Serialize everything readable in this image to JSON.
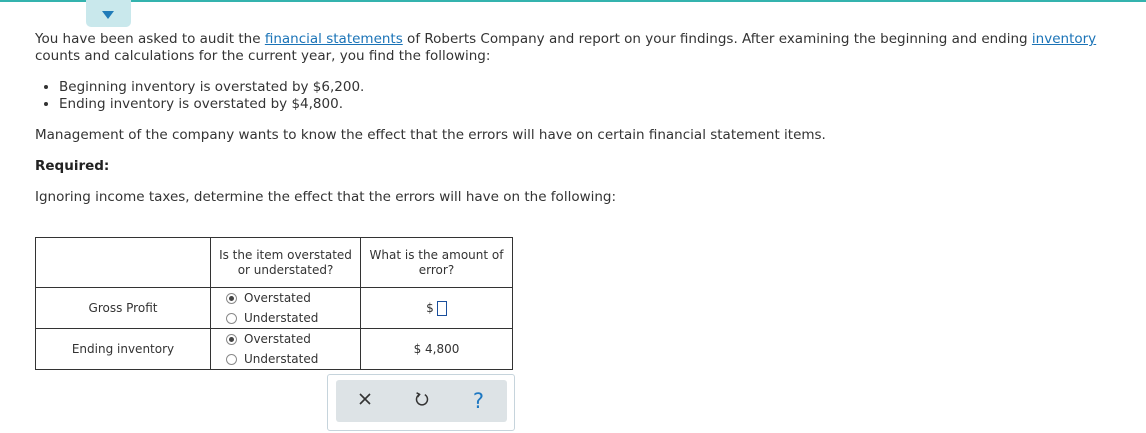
{
  "intro": {
    "part1": "You have been asked to audit the ",
    "link1": "financial statements",
    "part2": " of Roberts Company and report on your findings. After examining the beginning and ending ",
    "link2": "inventory",
    "line2": "counts and calculations for the current year, you find the following:"
  },
  "bullets": [
    "Beginning inventory is overstated by $6,200.",
    "Ending inventory is overstated by $4,800."
  ],
  "management_text": "Management of the company wants to know the effect that the errors will have on certain financial statement items.",
  "required_label": "Required:",
  "instruction": "Ignoring income taxes, determine the effect that the errors will have on the following:",
  "table": {
    "col2_header_line1": "Is the item overstated",
    "col2_header_line2": "or understated?",
    "col3_header_line1": "What is the amount of",
    "col3_header_line2": "error?",
    "rows": [
      {
        "item": "Gross Profit",
        "option_over": "Overstated",
        "option_under": "Understated",
        "selected": "Overstated",
        "currency": "$",
        "amount": ""
      },
      {
        "item": "Ending inventory",
        "option_over": "Overstated",
        "option_under": "Understated",
        "selected": "Overstated",
        "currency": "$",
        "amount": "4,800"
      }
    ]
  },
  "toolbar": {
    "clear_glyph": "✕",
    "help_glyph": "?"
  },
  "icons": {
    "collapse": "chevron-down-icon",
    "clear": "close-icon",
    "reset": "reset-icon",
    "help": "help-icon"
  },
  "colors": {
    "accent": "#34b3ae",
    "link": "#1a73b7",
    "tab_bg": "#c9e8ec",
    "toolbar_bg": "#dde3e6"
  }
}
